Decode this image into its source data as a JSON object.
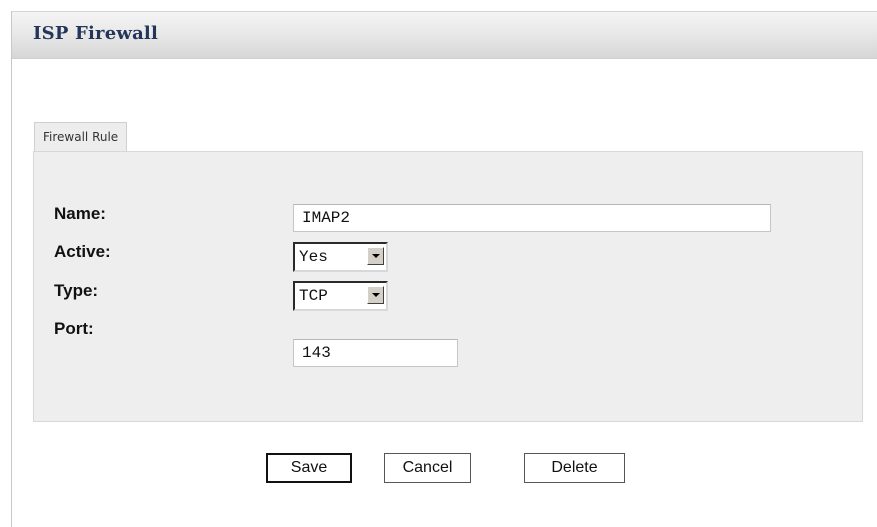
{
  "header": {
    "title": "ISP Firewall"
  },
  "tabs": [
    {
      "label": "Firewall Rule"
    }
  ],
  "form": {
    "name": {
      "label": "Name:",
      "value": "IMAP2"
    },
    "active": {
      "label": "Active:",
      "value": "Yes"
    },
    "type": {
      "label": "Type:",
      "value": "TCP"
    },
    "port": {
      "label": "Port:",
      "value": "143"
    }
  },
  "buttons": {
    "save": "Save",
    "cancel": "Cancel",
    "delete": "Delete"
  },
  "icons": {
    "select_arrow": "chevron-down-icon"
  }
}
